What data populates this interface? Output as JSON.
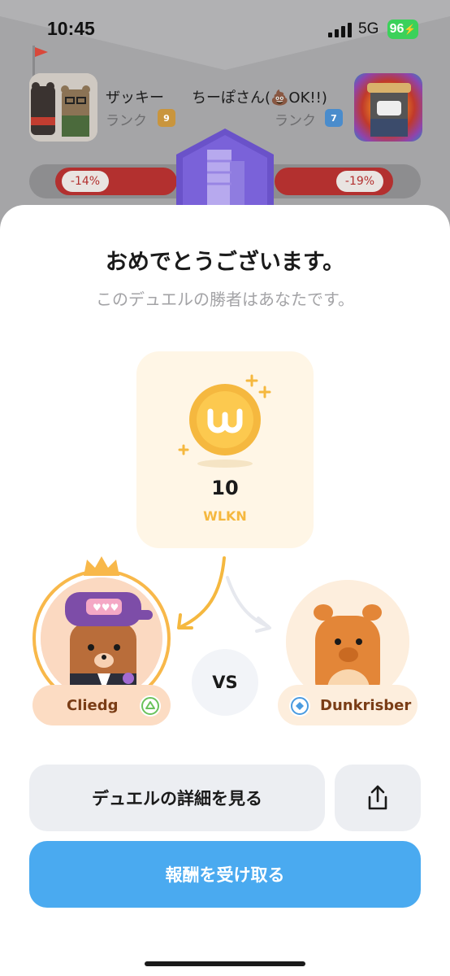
{
  "status_bar": {
    "time": "10:45",
    "network": "5G",
    "battery": "96"
  },
  "duel": {
    "left_user": {
      "name": "ザッキー",
      "rank_label": "ランク",
      "rank": "9"
    },
    "right_user": {
      "name": "ちーぽさん(💩OK!!)",
      "rank_label": "ランク",
      "rank": "7"
    },
    "left_change": "-14%",
    "right_change": "-19%"
  },
  "result": {
    "title": "おめでとうございます。",
    "subtitle": "このデュエルの勝者はあなたです。",
    "reward_amount": "10",
    "reward_unit": "WLKN"
  },
  "players": {
    "winner": {
      "name": "Cliedg"
    },
    "vs": "VS",
    "opponent": {
      "name": "Dunkrisber"
    }
  },
  "buttons": {
    "details": "デュエルの詳細を見る",
    "claim": "報酬を受け取る"
  },
  "colors": {
    "accent_blue": "#4aaaf0",
    "gold": "#f5b83f",
    "loss_red": "#b3302f"
  }
}
